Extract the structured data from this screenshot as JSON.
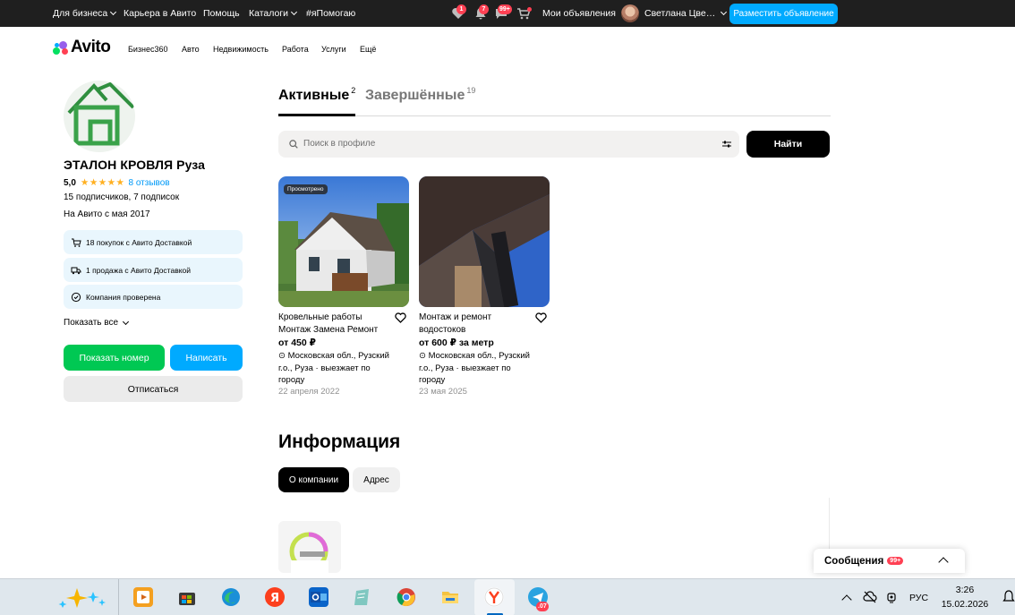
{
  "topbar": {
    "for_business": "Для бизнеса",
    "career": "Карьера в Авито",
    "help": "Помощь",
    "catalogs": "Каталоги",
    "help_hashtag": "#яПомогаю",
    "favorites_badge": "1",
    "notifications_badge": "7",
    "chat_badge": "99+",
    "my_ads": "Мои объявления",
    "user_name": "Светлана Цве…",
    "post_ad": "Разместить объявление"
  },
  "header": {
    "logo_text": "Avito",
    "nav": [
      "Бизнес360",
      "Авто",
      "Недвижимость",
      "Работа",
      "Услуги",
      "Ещё"
    ]
  },
  "profile": {
    "name": "ЭТАЛОН КРОВЛЯ Руза",
    "rating": "5,0",
    "stars": "★★★★★",
    "reviews": "8 отзывов",
    "subscribers": "15 подписчиков, 7 подписок",
    "since": "На Авито с мая 2017",
    "badges": [
      "18 покупок с Авито Доставкой",
      "1 продажа с Авито Доставкой",
      "Компания проверена"
    ],
    "show_all": "Показать все",
    "show_phone": "Показать номер",
    "write": "Написать",
    "unsubscribe": "Отписаться"
  },
  "tabs": {
    "active": "Активные",
    "active_count": "2",
    "finished": "Завершённые",
    "finished_count": "19"
  },
  "search": {
    "placeholder": "Поиск в профиле",
    "button": "Найти"
  },
  "listings": [
    {
      "viewed": "Просмотрено",
      "title": "Кровельные работы Монтаж Замена Ремонт",
      "price": "от 450 ₽",
      "location": "Московская обл., Рузский г.о., Руза · выезжает по городу",
      "date": "22 апреля 2022"
    },
    {
      "title": "Монтаж и ремонт водостоков",
      "price": "от 600 ₽ за метр",
      "location": "Московская обл., Рузский г.о., Руза · выезжает по городу",
      "date": "23 мая 2025"
    }
  ],
  "info": {
    "title": "Информация",
    "tab_company": "О компании",
    "tab_address": "Адрес"
  },
  "messages": {
    "label": "Сообщения",
    "badge": "99+"
  },
  "taskbar": {
    "telegram_badge": ".07",
    "language": "РУС",
    "time": "3:26",
    "date": "15.02.2026"
  },
  "colors": {
    "accent_blue": "#00aaff",
    "link_blue": "#0099f7",
    "action_green": "#00c853",
    "badge_red": "#ff4053",
    "star_orange": "#ffb021",
    "info_box_bg": "#e9f6fd"
  }
}
